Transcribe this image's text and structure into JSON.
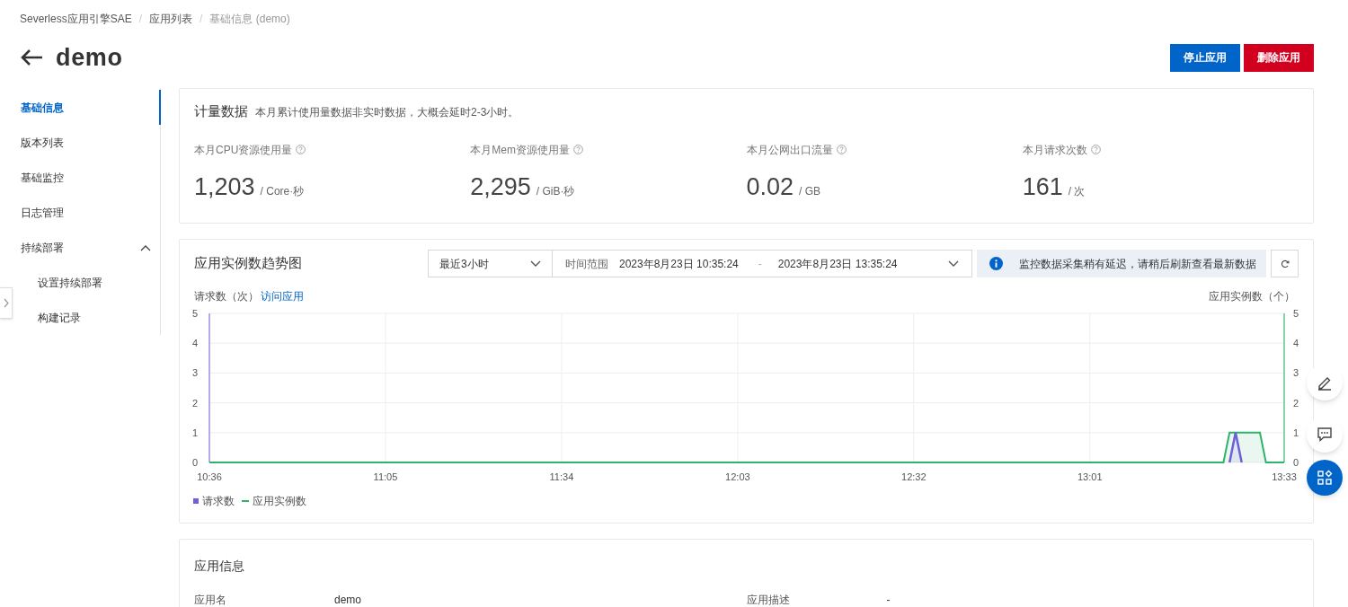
{
  "breadcrumb": [
    {
      "label": "Severless应用引擎SAE",
      "current": false,
      "separator": "/"
    },
    {
      "label": "应用列表",
      "current": false,
      "separator": "/"
    },
    {
      "label": "基础信息 (demo)",
      "current": true
    }
  ],
  "page_title": "demo",
  "actions": [
    {
      "label": "停止应用",
      "kind": "primary"
    },
    {
      "label": "删除应用",
      "kind": "danger"
    }
  ],
  "sidebar": {
    "items": [
      {
        "label": "基础信息",
        "selected": true
      },
      {
        "label": "版本列表",
        "selected": false
      },
      {
        "label": "基础监控",
        "selected": false
      },
      {
        "label": "日志管理",
        "selected": false
      },
      {
        "label": "持续部署",
        "selected": false,
        "expanded": true,
        "children": [
          {
            "label": "设置持续部署",
            "selected": false
          },
          {
            "label": "构建记录",
            "selected": false
          }
        ]
      }
    ]
  },
  "metering": {
    "title": "计量数据",
    "note": "本月累计使用量数据非实时数据，大概会延时2-3小时。",
    "metrics": [
      {
        "label": "本月CPU资源使用量",
        "value": "1,203",
        "unit": "/ Core·秒"
      },
      {
        "label": "本月Mem资源使用量",
        "value": "2,295",
        "unit": "/ GiB·秒"
      },
      {
        "label": "本月公网出口流量",
        "value": "0.02",
        "unit": "/ GB"
      },
      {
        "label": "本月请求次数",
        "value": "161",
        "unit": "/ 次"
      }
    ]
  },
  "trend": {
    "title": "应用实例数趋势图",
    "range_select": {
      "value": "最近3小时"
    },
    "time_range": {
      "label": "时间范围",
      "start": "2023年8月23日 10:35:24",
      "separator": "-",
      "end": "2023年8月23日 13:35:24"
    },
    "notice": "监控数据采集稍有延迟，请稍后刷新查看最新数据",
    "link": "访问应用",
    "right_axis_label": "应用实例数（个）",
    "right_axis_ticks": [
      "5",
      "4",
      "3",
      "2",
      "1",
      "0"
    ],
    "chart_data": {
      "type": "line",
      "grid": true,
      "ylabel": "请求数（次）",
      "ylim": [
        0,
        5
      ],
      "categories": [
        "10:36",
        null,
        null,
        null,
        null,
        null,
        null,
        null,
        null,
        null,
        null,
        null,
        null,
        null,
        null,
        null,
        null,
        null,
        null,
        null,
        null,
        null,
        null,
        null,
        null,
        null,
        null,
        null,
        null,
        "11:05",
        null,
        null,
        null,
        null,
        null,
        null,
        null,
        null,
        null,
        null,
        null,
        null,
        null,
        null,
        null,
        null,
        null,
        null,
        null,
        null,
        null,
        null,
        null,
        null,
        null,
        null,
        null,
        null,
        "11:34",
        null,
        null,
        null,
        null,
        null,
        null,
        null,
        null,
        null,
        null,
        null,
        null,
        null,
        null,
        null,
        null,
        null,
        null,
        null,
        null,
        null,
        null,
        null,
        null,
        null,
        null,
        null,
        null,
        "12:03",
        null,
        null,
        null,
        null,
        null,
        null,
        null,
        null,
        null,
        null,
        null,
        null,
        null,
        null,
        null,
        null,
        null,
        null,
        null,
        null,
        null,
        null,
        null,
        null,
        null,
        null,
        null,
        null,
        "12:32",
        null,
        null,
        null,
        null,
        null,
        null,
        null,
        null,
        null,
        null,
        null,
        null,
        null,
        null,
        null,
        null,
        null,
        null,
        null,
        null,
        null,
        null,
        null,
        null,
        null,
        null,
        null,
        null,
        "13:01",
        null,
        null,
        null,
        null,
        null,
        null,
        null,
        null,
        null,
        null,
        null,
        null,
        null,
        null,
        null,
        null,
        null,
        null,
        null,
        null,
        null,
        null,
        null,
        null,
        null,
        null,
        null,
        null,
        null,
        null,
        null,
        "13:33"
      ],
      "yticks": [
        {
          "value": 0,
          "label": "0"
        },
        {
          "value": 1,
          "label": "1"
        },
        {
          "value": 2,
          "label": "2"
        },
        {
          "value": 3,
          "label": "3"
        },
        {
          "value": 4,
          "label": "4"
        },
        {
          "value": 5,
          "label": "5"
        }
      ],
      "series": [
        {
          "name": "请求数",
          "color": "#6c5fd9",
          "values": [
            null,
            null,
            null,
            null,
            null,
            null,
            null,
            null,
            null,
            null,
            null,
            null,
            null,
            null,
            null,
            null,
            null,
            null,
            null,
            null,
            null,
            null,
            null,
            null,
            null,
            null,
            null,
            null,
            null,
            null,
            null,
            null,
            null,
            null,
            null,
            null,
            null,
            null,
            null,
            null,
            null,
            null,
            null,
            null,
            null,
            null,
            null,
            null,
            null,
            null,
            null,
            null,
            null,
            null,
            null,
            null,
            null,
            null,
            null,
            null,
            null,
            null,
            null,
            null,
            null,
            null,
            null,
            null,
            null,
            null,
            null,
            null,
            null,
            null,
            null,
            null,
            null,
            null,
            null,
            null,
            null,
            null,
            null,
            null,
            null,
            null,
            null,
            null,
            null,
            null,
            null,
            null,
            null,
            null,
            null,
            null,
            null,
            null,
            null,
            null,
            null,
            null,
            null,
            null,
            null,
            null,
            null,
            null,
            null,
            null,
            null,
            null,
            null,
            null,
            null,
            null,
            null,
            null,
            null,
            null,
            null,
            null,
            null,
            null,
            null,
            null,
            null,
            null,
            null,
            null,
            null,
            null,
            null,
            null,
            null,
            null,
            null,
            null,
            null,
            null,
            null,
            null,
            null,
            null,
            null,
            null,
            null,
            null,
            null,
            null,
            null,
            null,
            null,
            null,
            null,
            null,
            null,
            null,
            null,
            null,
            null,
            null,
            null,
            null,
            null,
            null,
            null,
            null,
            0,
            1,
            0,
            null,
            null,
            null,
            null,
            null,
            null,
            null
          ]
        },
        {
          "name": "应用实例数",
          "color": "#2eb36b",
          "values": [
            0,
            0,
            0,
            0,
            0,
            0,
            0,
            0,
            0,
            0,
            0,
            0,
            0,
            0,
            0,
            0,
            0,
            0,
            0,
            0,
            0,
            0,
            0,
            0,
            0,
            0,
            0,
            0,
            0,
            0,
            0,
            0,
            0,
            0,
            0,
            0,
            0,
            0,
            0,
            0,
            0,
            0,
            0,
            0,
            0,
            0,
            0,
            0,
            0,
            0,
            0,
            0,
            0,
            0,
            0,
            0,
            0,
            0,
            0,
            0,
            0,
            0,
            0,
            0,
            0,
            0,
            0,
            0,
            0,
            0,
            0,
            0,
            0,
            0,
            0,
            0,
            0,
            0,
            0,
            0,
            0,
            0,
            0,
            0,
            0,
            0,
            0,
            0,
            0,
            0,
            0,
            0,
            0,
            0,
            0,
            0,
            0,
            0,
            0,
            0,
            0,
            0,
            0,
            0,
            0,
            0,
            0,
            0,
            0,
            0,
            0,
            0,
            0,
            0,
            0,
            0,
            0,
            0,
            0,
            0,
            0,
            0,
            0,
            0,
            0,
            0,
            0,
            0,
            0,
            0,
            0,
            0,
            0,
            0,
            0,
            0,
            0,
            0,
            0,
            0,
            0,
            0,
            0,
            0,
            0,
            0,
            0,
            0,
            0,
            0,
            0,
            0,
            0,
            0,
            0,
            0,
            0,
            0,
            0,
            0,
            0,
            0,
            0,
            0,
            0,
            0,
            0,
            0,
            1,
            1,
            1,
            1,
            1,
            1,
            0,
            0,
            0,
            0
          ]
        }
      ]
    }
  },
  "app_info": {
    "title": "应用信息",
    "fields": [
      {
        "label": "应用名",
        "value": "demo"
      },
      {
        "label": "应用描述",
        "value": "-"
      }
    ]
  }
}
